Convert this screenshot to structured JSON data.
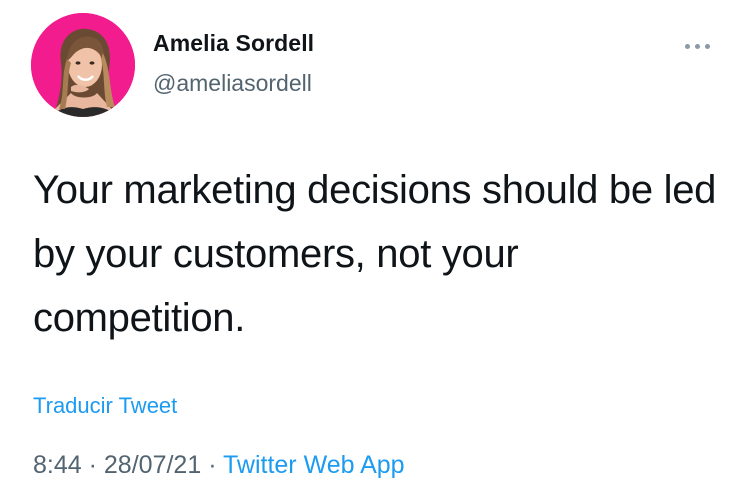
{
  "tweet": {
    "author": {
      "display_name": "Amelia Sordell",
      "handle": "@ameliasordell",
      "avatar_icon": "profile-photo-avatar"
    },
    "more_icon": "more-options-icon",
    "text": "Your marketing decisions should be led by your customers, not your competition.",
    "translate_label": "Traducir Tweet",
    "time": "8:44",
    "separator": "·",
    "date": "28/07/21",
    "source": "Twitter Web App"
  },
  "colors": {
    "accent": "#1d9bf0",
    "avatar_background": "#f21c8f",
    "text_primary": "#0f1419",
    "text_secondary": "#536471"
  }
}
